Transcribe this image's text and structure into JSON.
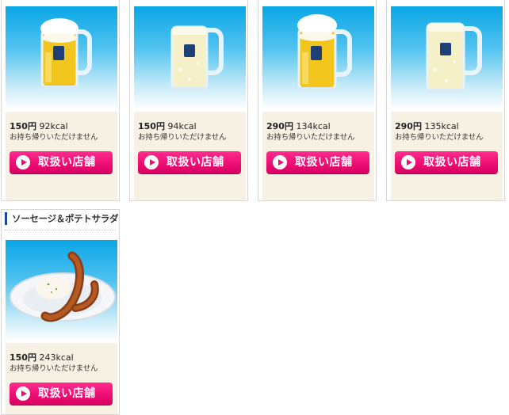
{
  "products": [
    {
      "price": "150円",
      "kcal": "92kcal",
      "note": "お持ち帰りいただけません",
      "button": "取扱い店舗",
      "image": "beer-mug-icon"
    },
    {
      "price": "150円",
      "kcal": "94kcal",
      "note": "お持ち帰りいただけません",
      "button": "取扱い店舗",
      "image": "highball-mug-icon"
    },
    {
      "price": "290円",
      "kcal": "134kcal",
      "note": "お持ち帰りいただけません",
      "button": "取扱い店舗",
      "image": "beer-mug-icon"
    },
    {
      "price": "290円",
      "kcal": "135kcal",
      "note": "お持ち帰りいただけません",
      "button": "取扱い店舗",
      "image": "highball-mug-icon"
    },
    {
      "heading": "ソーセージ＆ポテトサラダ",
      "price": "150円",
      "kcal": "243kcal",
      "note": "お持ち帰りいただけません",
      "button": "取扱い店舗",
      "image": "sausage-potato-plate-icon"
    }
  ],
  "colors": {
    "button": "#ee0f74",
    "heading_bar": "#1a4a9a",
    "info_bg": "#f7f1e3",
    "sky": "#0aa6e6"
  }
}
